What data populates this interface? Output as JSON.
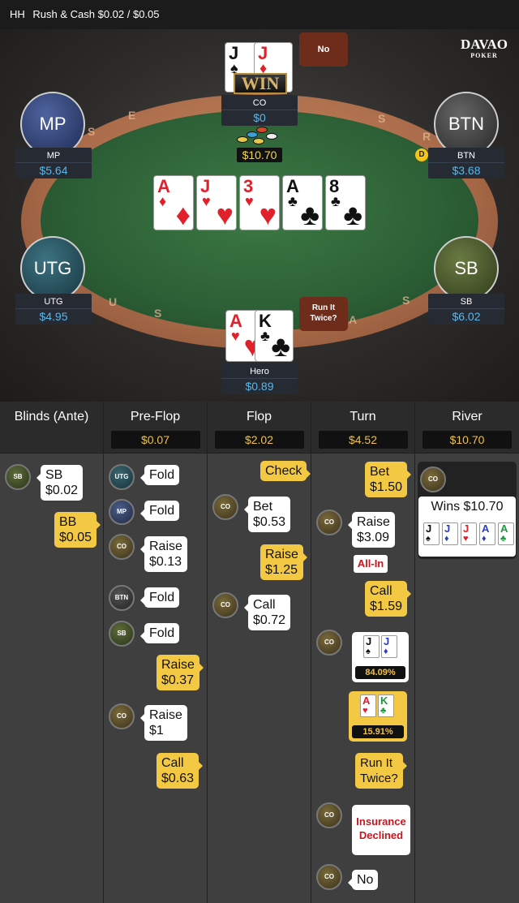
{
  "header": {
    "mode": "HH",
    "title": "Rush & Cash $0.02 / $0.05"
  },
  "logo": {
    "name": "DAVAO",
    "sub": "POKER"
  },
  "table": {
    "rail_letters": [
      "E",
      "S",
      "S",
      "R",
      "U",
      "S",
      "A",
      "S"
    ],
    "seats": [
      {
        "pos": "MP",
        "stack": "$5.64"
      },
      {
        "pos": "BTN",
        "stack": "$3.68"
      },
      {
        "pos": "UTG",
        "stack": "$4.95"
      },
      {
        "pos": "SB",
        "stack": "$6.02"
      },
      {
        "pos": "CO",
        "stack": "$0"
      },
      {
        "pos": "Hero",
        "stack": "$0.89"
      }
    ],
    "co_bubble": "No",
    "hero_bubble": "Run It Twice?",
    "win": "WIN",
    "pot": "$10.70",
    "dealer": "D",
    "co_cards": [
      {
        "r": "J",
        "s": "♠",
        "c": "blk"
      },
      {
        "r": "J",
        "s": "♦",
        "c": "red"
      }
    ],
    "hero_cards": [
      {
        "r": "A",
        "s": "♥",
        "c": "red"
      },
      {
        "r": "K",
        "s": "♣",
        "c": "blk"
      }
    ],
    "board": [
      {
        "r": "A",
        "s": "♦",
        "c": "red"
      },
      {
        "r": "J",
        "s": "♥",
        "c": "red"
      },
      {
        "r": "3",
        "s": "♥",
        "c": "red"
      },
      {
        "r": "A",
        "s": "♣",
        "c": "blk"
      },
      {
        "r": "8",
        "s": "♣",
        "c": "blk"
      }
    ]
  },
  "history": {
    "columns": [
      {
        "title": "Blinds (Ante)",
        "pot": ""
      },
      {
        "title": "Pre-Flop",
        "pot": "$0.07"
      },
      {
        "title": "Flop",
        "pot": "$2.02"
      },
      {
        "title": "Turn",
        "pot": "$4.52"
      },
      {
        "title": "River",
        "pot": "$10.70"
      }
    ],
    "blinds": [
      {
        "who": "SB",
        "text": "SB\n$0.02"
      },
      {
        "who": "",
        "text": "BB\n$0.05"
      }
    ],
    "preflop": [
      {
        "who": "UTG",
        "text": "Fold"
      },
      {
        "who": "MP",
        "text": "Fold"
      },
      {
        "who": "CO",
        "text": "Raise\n$0.13"
      },
      {
        "who": "BTN",
        "text": "Fold"
      },
      {
        "who": "SB",
        "text": "Fold"
      },
      {
        "who": "",
        "text": "Raise\n$0.37"
      },
      {
        "who": "CO",
        "text": "Raise\n$1"
      },
      {
        "who": "",
        "text": "Call\n$0.63"
      }
    ],
    "flop": [
      {
        "who": "",
        "text": "Check"
      },
      {
        "who": "CO",
        "text": "Bet\n$0.53"
      },
      {
        "who": "",
        "text": "Raise\n$1.25"
      },
      {
        "who": "CO",
        "text": "Call\n$0.72"
      }
    ],
    "turn": [
      {
        "who": "",
        "text": "Bet\n$1.50"
      },
      {
        "who": "CO",
        "text": "Raise\n$3.09"
      },
      {
        "who": "",
        "text": "All-In"
      },
      {
        "who": "",
        "text": "Call\n$1.59"
      },
      {
        "who": "CO",
        "text": "84.09%"
      },
      {
        "who": "",
        "text": "15.91%"
      },
      {
        "who": "",
        "text": "Run It\nTwice?"
      },
      {
        "who": "CO",
        "text": "Insurance\nDeclined"
      },
      {
        "who": "CO",
        "text": "No"
      }
    ],
    "river": {
      "who": "CO",
      "text": "Wins $10.70"
    }
  },
  "colors": {
    "accent": "#f3c944",
    "stack": "#57b8ec",
    "felt": "#2c5f35"
  }
}
